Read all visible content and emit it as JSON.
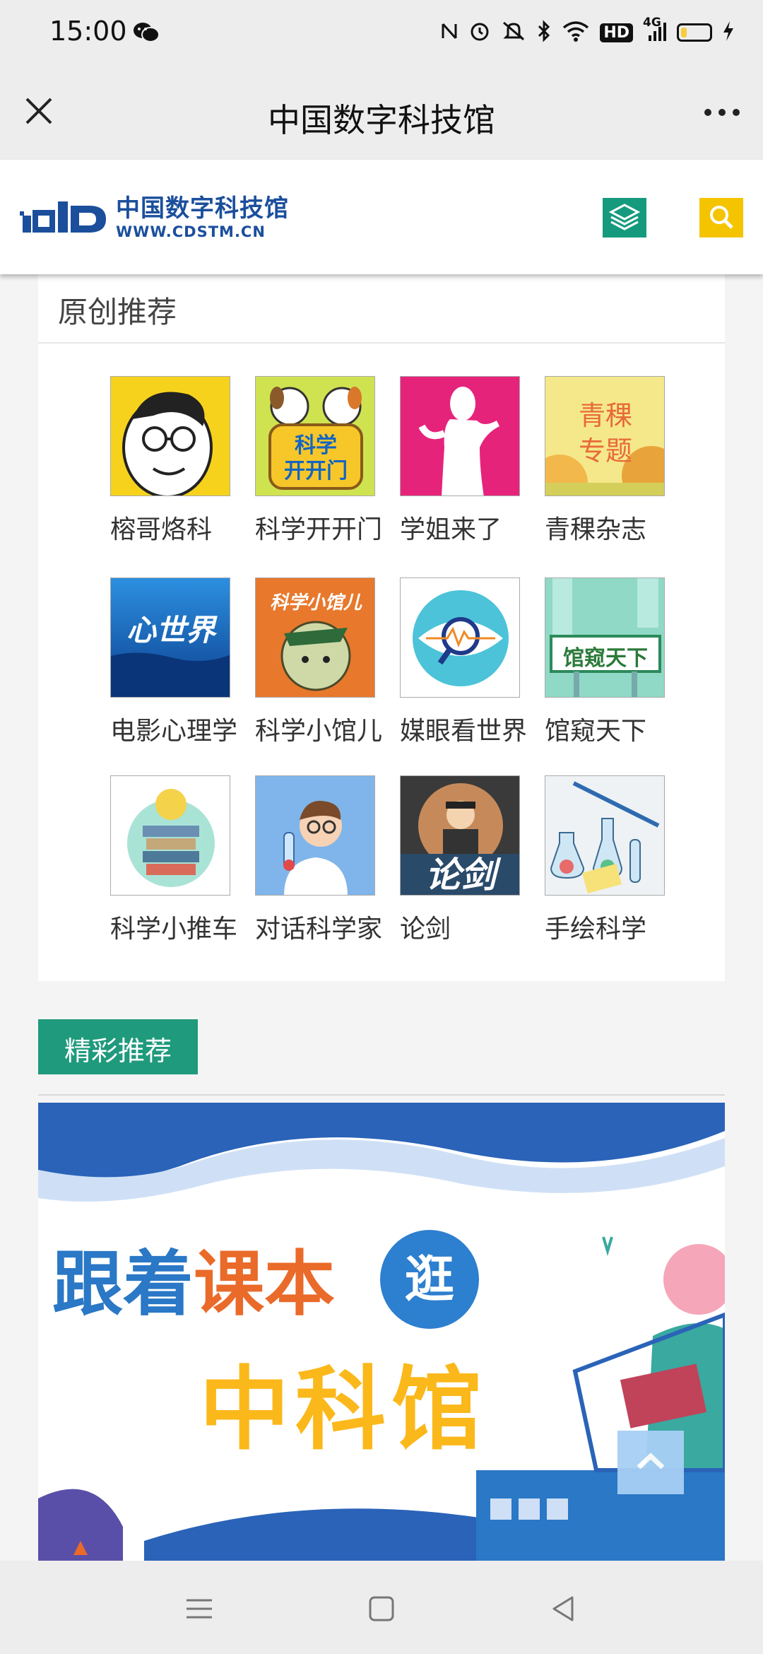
{
  "status_bar": {
    "time": "15:00",
    "network_label": "4G",
    "hd_label": "HD",
    "battery_level": 0.2,
    "icons": [
      "wechat-icon",
      "nfc-icon",
      "alarm-icon",
      "mute-icon",
      "bluetooth-icon",
      "wifi-icon",
      "hd-icon",
      "signal-icon",
      "battery-icon",
      "charging-icon"
    ]
  },
  "title_bar": {
    "title": "中国数字科技馆"
  },
  "site_header": {
    "logo_cn": "中国数字科技馆",
    "logo_url": "WWW.CDSTM.CN"
  },
  "original_section": {
    "title": "原创推荐",
    "items": [
      {
        "label": "榕哥烙科"
      },
      {
        "label": "科学开开门"
      },
      {
        "label": "学姐来了"
      },
      {
        "label": "青稞杂志"
      },
      {
        "label": "电影心理学"
      },
      {
        "label": "科学小馆儿"
      },
      {
        "label": "媒眼看世界"
      },
      {
        "label": "馆窥天下"
      },
      {
        "label": "科学小推车"
      },
      {
        "label": "对话科学家"
      },
      {
        "label": "论剑"
      },
      {
        "label": "手绘科学"
      }
    ],
    "thumb_text": {
      "kexue": "科学",
      "kaikaimen": "开开门",
      "qingke1": "青稞",
      "qingke2": "专题",
      "xinshijie": "心世界",
      "xiaoguaner": "科学小馆儿",
      "guankui": "馆窥天下",
      "lunjian": "论剑"
    }
  },
  "featured_section": {
    "title": "精彩推荐",
    "banner": {
      "line1_part1": "跟着",
      "line1_part2": "课本",
      "circle_char": "逛",
      "line2": "中科馆"
    }
  },
  "colors": {
    "accent_green": "#1f9a7c",
    "accent_yellow": "#f5c400",
    "banner_blue": "#2a78c6",
    "banner_orange": "#ea6a2a",
    "banner_gold": "#fbb81b"
  }
}
